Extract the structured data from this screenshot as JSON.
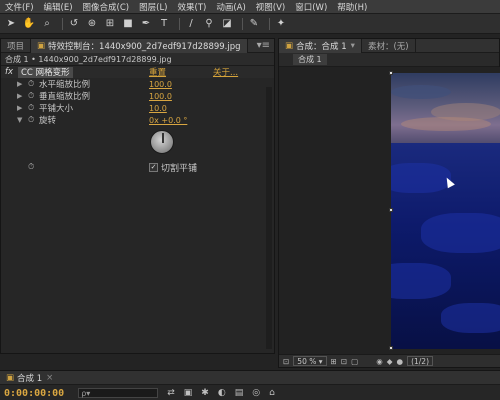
{
  "menu": [
    "文件(F)",
    "编辑(E)",
    "图像合成(C)",
    "图层(L)",
    "效果(T)",
    "动画(A)",
    "视图(V)",
    "窗口(W)",
    "帮助(H)"
  ],
  "toolbar": {
    "tools": [
      "selection-icon",
      "hand-icon",
      "zoom-icon",
      "rotate-icon",
      "camera-orbit-icon",
      "pan-behind-icon",
      "rectangle-icon",
      "pen-icon",
      "text-icon",
      "brush-icon",
      "clone-stamp-icon",
      "eraser-icon",
      "roto-brush-icon",
      "puppet-pin-icon"
    ]
  },
  "left_panel": {
    "tabs": {
      "project": "项目",
      "effects": "特效控制台：1440x900_2d7edf917d28899.jpg"
    },
    "breadcrumb": "合成 1 • 1440x900_2d7edf917d28899.jpg",
    "effect": {
      "name": "CC 网格变形",
      "reset_label": "重置",
      "about_label": "关于...",
      "properties": [
        {
          "label": "水平缩放比例",
          "value": "100.0"
        },
        {
          "label": "垂直缩放比例",
          "value": "100.0"
        },
        {
          "label": "平铺大小",
          "value": "10.0"
        },
        {
          "label": "旋转",
          "value": "0x +0.0 °"
        }
      ],
      "checkbox_label": "切割平铺",
      "checkbox_checked": true
    }
  },
  "right_panel": {
    "tabs": {
      "composition": "合成：合成 1",
      "footage": "素材：(无)"
    },
    "sub_tab": "合成 1",
    "footer": {
      "zoom": "50 %",
      "resolution": "(1/2)"
    }
  },
  "timeline": {
    "tab": "合成 1",
    "timecode": "0:00:00:00",
    "search_placeholder": "ρ▾"
  },
  "colors": {
    "accent": "#d9a641",
    "panel_bg": "#262626",
    "header_bg": "#313131"
  }
}
